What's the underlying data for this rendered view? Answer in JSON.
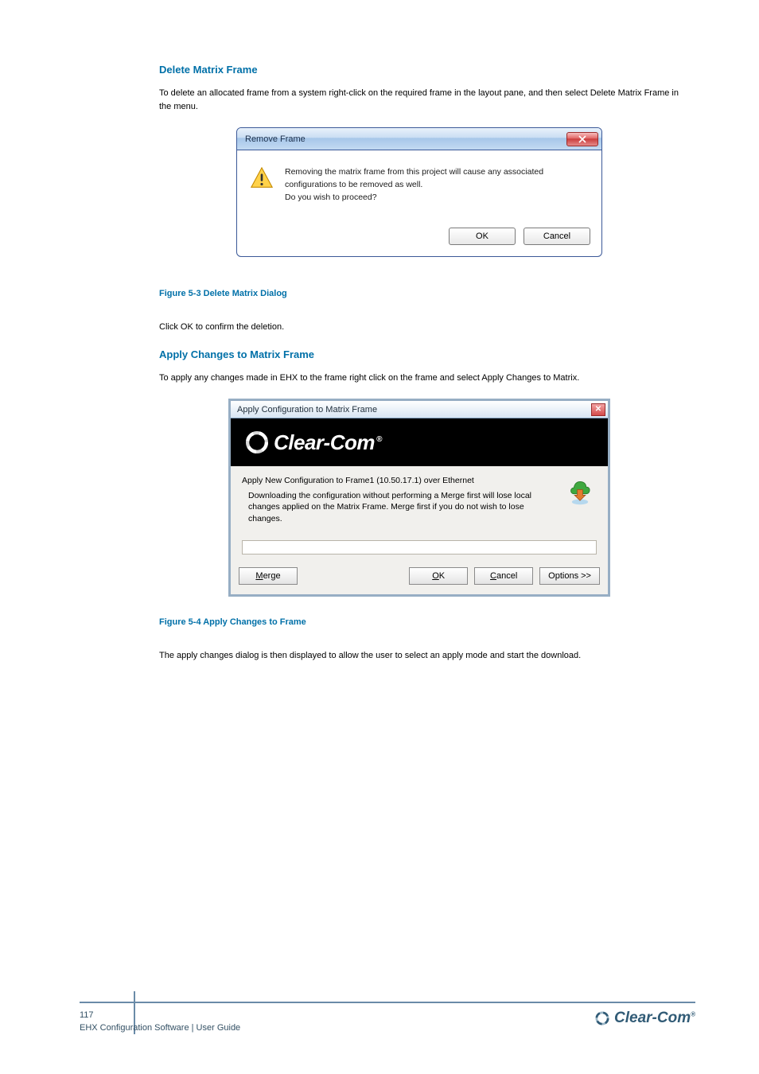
{
  "section": {
    "heading": "Delete Matrix Frame",
    "intro": "To delete an allocated frame from a system right-click on the required frame in the layout pane, and then select Delete Matrix Frame in the menu.",
    "confirm_text": "Click OK to confirm the deletion.",
    "fig1_caption": "Figure 5-3 Delete Matrix Dialog",
    "fig2_caption": "Figure 5-4 Apply Changes to Frame"
  },
  "section2": {
    "heading": "Apply Changes to Matrix Frame",
    "intro": "To apply any changes made in EHX to the frame right click on the frame and select Apply Changes to Matrix.",
    "post_intro": "The apply changes dialog is then displayed to allow the user to select an apply mode and start the download."
  },
  "dlg1": {
    "title": "Remove Frame",
    "msg_line1": "Removing the matrix frame from this project will cause any associated configurations to be removed as well.",
    "msg_line2": "Do you wish to proceed?",
    "ok": "OK",
    "cancel": "Cancel"
  },
  "dlg2": {
    "title": "Apply Configuration to Matrix Frame",
    "brand": "Clear-Com",
    "line1": "Apply New Configuration to Frame1 (10.50.17.1) over Ethernet",
    "line2": "Downloading the configuration without performing a Merge first will lose local changes applied on the Matrix Frame. Merge first if you do not wish to lose changes.",
    "merge": "Merge",
    "ok": "OK",
    "cancel": "Cancel",
    "options": "Options >>"
  },
  "footer": {
    "page": "117",
    "doc": "EHX Configuration Software | User Guide",
    "brand": "Clear-Com"
  }
}
